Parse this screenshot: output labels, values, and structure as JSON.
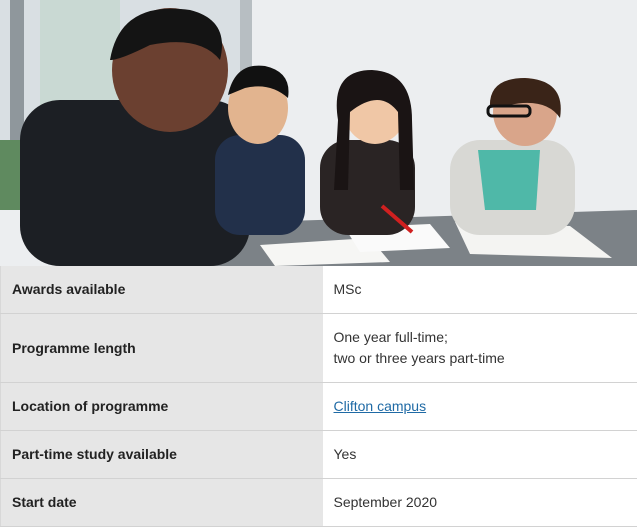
{
  "hero": {
    "colors": {
      "wall": "#e9ecee",
      "window": "#cfd6da",
      "table": "#8a8f93"
    }
  },
  "table": {
    "rows": [
      {
        "label": "Awards available",
        "value_lines": [
          "MSc"
        ]
      },
      {
        "label": "Programme length",
        "value_lines": [
          "One year full-time;",
          "two or three years part-time"
        ]
      },
      {
        "label": "Location of programme",
        "link_text": "Clifton campus"
      },
      {
        "label": "Part-time study available",
        "value_lines": [
          "Yes"
        ]
      },
      {
        "label": "Start date",
        "value_lines": [
          "September 2020"
        ]
      }
    ],
    "colors": {
      "label_bg": "#e6e6e6",
      "link": "#1f6aa5",
      "border": "#d2d2d2"
    }
  }
}
